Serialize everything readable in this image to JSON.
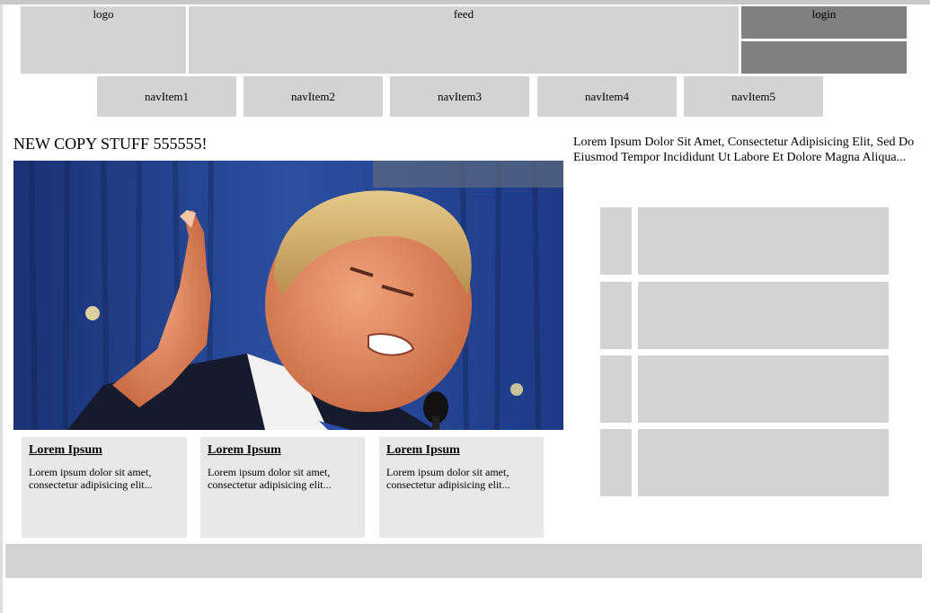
{
  "header": {
    "logo_label": "logo",
    "feed_label": "feed",
    "login_label": "login"
  },
  "nav": {
    "items": [
      {
        "label": "navItem1"
      },
      {
        "label": "navItem2"
      },
      {
        "label": "navItem3"
      },
      {
        "label": "navItem4"
      },
      {
        "label": "navItem5"
      }
    ]
  },
  "main": {
    "headline": "NEW COPY STUFF 555555!",
    "intro": "Lorem Ipsum Dolor Sit Amet, Consectetur Adipisicing Elit, Sed Do Eiusmod Tempor Incididunt Ut Labore Et Dolore Magna Aliqua...",
    "cards": [
      {
        "title": "Lorem Ipsum",
        "text": "Lorem ipsum dolor sit amet, consectetur adipisicing elit..."
      },
      {
        "title": "Lorem Ipsum",
        "text": "Lorem ipsum dolor sit amet, consectetur adipisicing elit..."
      },
      {
        "title": "Lorem Ipsum",
        "text": "Lorem ipsum dolor sit amet, consectetur adipisicing elit..."
      }
    ]
  },
  "colors": {
    "placeholder": "#d3d3d3",
    "login_box": "#808080",
    "card_bg": "#e8e8e8"
  }
}
